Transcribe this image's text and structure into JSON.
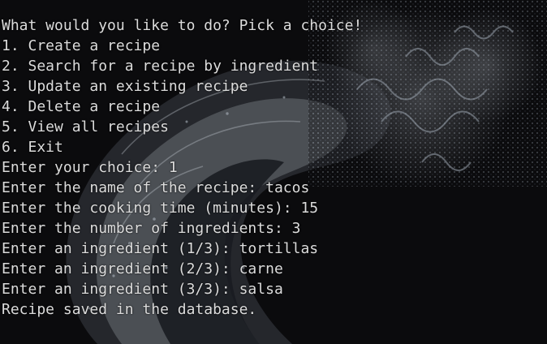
{
  "terminal": {
    "background_color": "#0b0b0d",
    "text_color": "#dcdcdc",
    "lines": [
      "What would you like to do? Pick a choice!",
      "1. Create a recipe",
      "2. Search for a recipe by ingredient",
      "3. Update an existing recipe",
      "4. Delete a recipe",
      "5. View all recipes",
      "6. Exit",
      "Enter your choice: 1",
      "Enter the name of the recipe: tacos",
      "Enter the cooking time (minutes): 15",
      "Enter the number of ingredients: 3",
      "Enter an ingredient (1/3): tortillas",
      "Enter an ingredient (2/3): carne",
      "Enter an ingredient (3/3): salsa",
      "Recipe saved in the database."
    ]
  }
}
